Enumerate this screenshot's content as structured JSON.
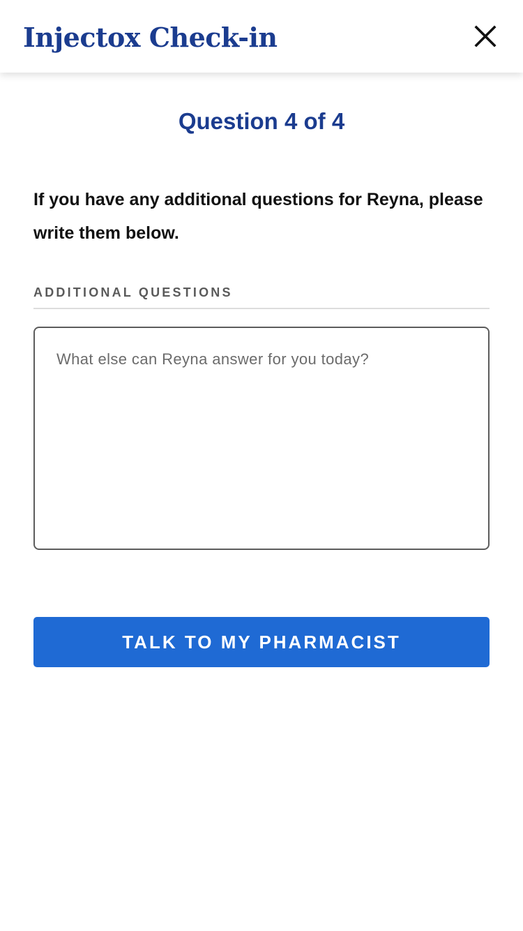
{
  "header": {
    "title": "Injectox Check-in",
    "close_icon": "close-icon"
  },
  "question": {
    "counter": "Question 4 of 4",
    "prompt": "If you have any additional questions for Reyna, please write them below."
  },
  "field": {
    "label": "ADDITIONAL QUESTIONS",
    "value": "",
    "placeholder": "What else can Reyna answer for you today?"
  },
  "actions": {
    "primary_label": "TALK TO MY PHARMACIST"
  },
  "colors": {
    "brand_navy": "#1b3c8f",
    "primary_button": "#1f6ad4",
    "text": "#111111",
    "label": "#5a5a5a"
  }
}
